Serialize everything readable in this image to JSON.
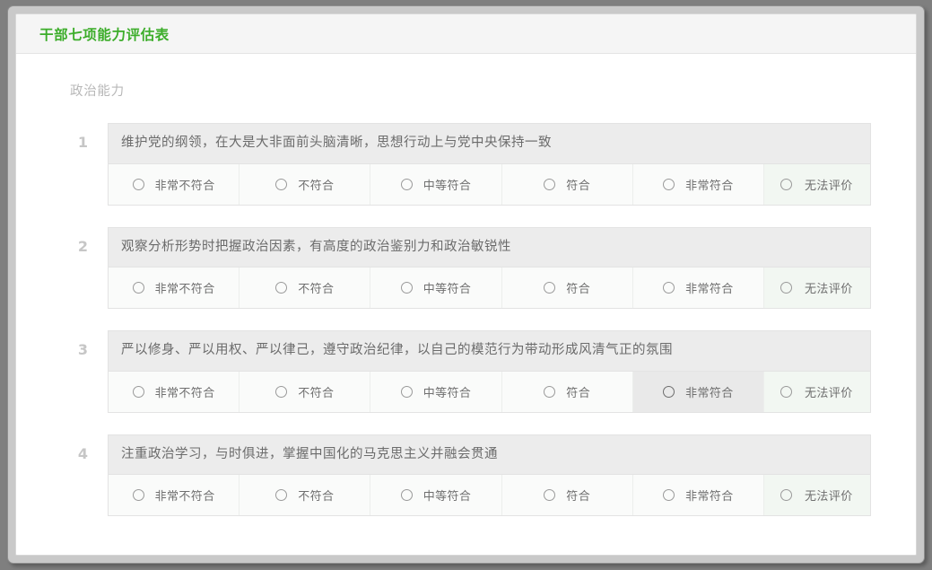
{
  "window": {
    "title": "干部七项能力评估表",
    "title_color": "#3cad2a"
  },
  "form": {
    "section_label": "政治能力",
    "options": [
      {
        "label": "非常不符合",
        "value": 1
      },
      {
        "label": "不符合",
        "value": 2
      },
      {
        "label": "中等符合",
        "value": 3
      },
      {
        "label": "符合",
        "value": 4
      },
      {
        "label": "非常符合",
        "value": 5
      },
      {
        "label": "无法评价",
        "value": 0
      }
    ],
    "questions": [
      {
        "number": "1",
        "text": "维护党的纲领，在大是大非面前头脑清晰，思想行动上与党中央保持一致",
        "selected": null,
        "hovered_index": null
      },
      {
        "number": "2",
        "text": "观察分析形势时把握政治因素，有高度的政治鉴别力和政治敏锐性",
        "selected": null,
        "hovered_index": null
      },
      {
        "number": "3",
        "text": "严以修身、严以用权、严以律己，遵守政治纪律，以自己的模范行为带动形成风清气正的氛围",
        "selected": null,
        "hovered_index": 4
      },
      {
        "number": "4",
        "text": "注重政治学习，与时俱进，掌握中国化的马克思主义并融会贯通",
        "selected": null,
        "hovered_index": null
      }
    ]
  },
  "colors": {
    "accent_green": "#3cad2a",
    "question_header_bg": "#ececec",
    "option_bg": "#fafbfa",
    "no_rating_bg": "#f2f7f2",
    "hover_bg": "#e9e9e9",
    "frame_gray": "#c9c9c9",
    "number_gray": "#c6c6c6"
  },
  "icons": {
    "radio": "radio-unchecked-icon"
  }
}
